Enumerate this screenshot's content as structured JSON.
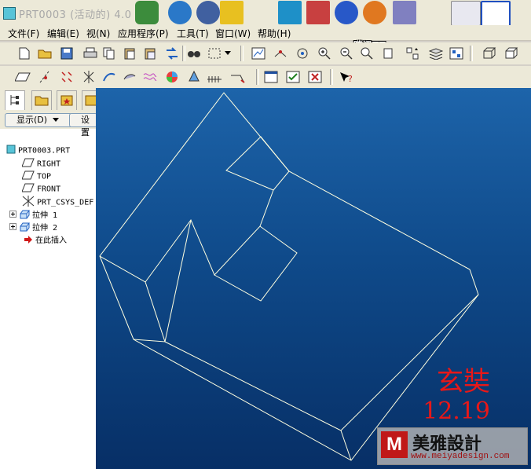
{
  "window": {
    "title": "PRT0003 (活动的) 4.0"
  },
  "tray_note": "腾讯TT",
  "menubar": {
    "items": [
      {
        "name": "file",
        "label": "文件(F)"
      },
      {
        "name": "edit",
        "label": "编辑(E)"
      },
      {
        "name": "view",
        "label": "视(N)"
      },
      {
        "name": "apps",
        "label": "应用程序(P)"
      },
      {
        "name": "tools",
        "label": "工具(T)"
      },
      {
        "name": "window",
        "label": "窗口(W)"
      },
      {
        "name": "help",
        "label": "帮助(H)"
      }
    ]
  },
  "toolbar1": {
    "icons": [
      "new-file-icon",
      "open-folder-icon",
      "save-icon",
      "print-icon",
      "copy-icon",
      "paste-icon",
      "paste-special-icon",
      "regenerate-icon",
      "find-icon",
      "select-box-icon",
      "dropdown-arrow-icon",
      "redraw-icon",
      "spin-center-icon",
      "orient-icon",
      "zoom-in-icon",
      "zoom-out-icon",
      "refit-icon",
      "reorient-icon",
      "saved-views-icon",
      "layers-icon",
      "model-tree-icon",
      "wireframe-icon",
      "hidden-line-icon"
    ]
  },
  "toolbar2": {
    "icons": [
      "datum-plane-icon",
      "datum-axis-icon",
      "datum-point-icon",
      "datum-csys-icon",
      "sketch-curve-icon",
      "shade-icon",
      "spline-icon",
      "color-icon",
      "light-icon",
      "analysis-icon",
      "annotation-icon",
      "window-icon",
      "checkbox-icon",
      "close-window-icon",
      "context-help-icon"
    ]
  },
  "left_panel": {
    "tabs": [
      "model-tree-tab",
      "folder-tab",
      "favorites-tab",
      "layers-tab"
    ],
    "show_label": "显示",
    "show_accel": "(D)",
    "settings_label": "设置"
  },
  "tree": {
    "root": "PRT0003.PRT",
    "items": [
      {
        "label": "RIGHT",
        "icon": "datum-plane-icon"
      },
      {
        "label": "TOP",
        "icon": "datum-plane-icon"
      },
      {
        "label": "FRONT",
        "icon": "datum-plane-icon"
      },
      {
        "label": "PRT_CSYS_DEF",
        "icon": "csys-icon"
      },
      {
        "label": "拉伸 1",
        "icon": "extrude-icon"
      },
      {
        "label": "拉伸 2",
        "icon": "extrude-icon"
      },
      {
        "label": "在此插入",
        "icon": "insert-here-icon"
      }
    ]
  },
  "signature": {
    "name": "玄奘",
    "date": "12.19"
  },
  "watermark": {
    "logo": "M",
    "brand": "美雅設計",
    "url": "www.meiyadesign.com"
  },
  "colors": {
    "viewport_top": "#1d64aa",
    "viewport_bottom": "#072f66",
    "wireframe": "#ffffe0",
    "signature": "#e81818"
  }
}
